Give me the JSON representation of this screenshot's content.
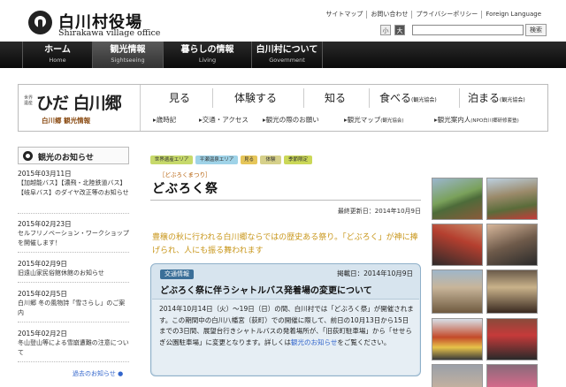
{
  "header": {
    "title": "白川村役場",
    "subtitle": "Shirakawa village office",
    "util_links": [
      "サイトマップ",
      "お問い合わせ",
      "プライバシーポリシー",
      "Foreign Language"
    ],
    "font_small": "小",
    "font_large": "大",
    "search_button": "検索"
  },
  "nav": [
    {
      "jp": "ホーム",
      "en": "Home"
    },
    {
      "jp": "観光情報",
      "en": "Sightseeing"
    },
    {
      "jp": "暮らしの情報",
      "en": "Living"
    },
    {
      "jp": "白川村について",
      "en": "Government"
    }
  ],
  "banner": {
    "logo_title": "ひだ 白川郷",
    "logo_tiny": "世界遺産",
    "logo_sub": "白川郷 観光情報",
    "categories": [
      {
        "label": "見る",
        "note": ""
      },
      {
        "label": "体験する",
        "note": ""
      },
      {
        "label": "知る",
        "note": ""
      },
      {
        "label": "食べる",
        "note": "(観光協会)"
      },
      {
        "label": "泊まる",
        "note": "(観光協会)"
      }
    ],
    "sub_links": [
      {
        "label": "歳時記",
        "note": ""
      },
      {
        "label": "交通・アクセス",
        "note": ""
      },
      {
        "label": "観光の際のお願い",
        "note": ""
      },
      {
        "label": "観光マップ",
        "note": "(観光協会)"
      },
      {
        "label": "観光案内人",
        "note": "(NPO白川郷研修套塾)"
      }
    ]
  },
  "news": {
    "heading": "観光のお知らせ",
    "items": [
      {
        "date": "2015年03月11日",
        "text": "【加越能バス】【濃飛・北陸鉄道バス】【岐阜バス】のダイヤ改正等のお知らせ"
      },
      {
        "date": "2015年02月23日",
        "text": "セルフリノベーション・ワークショップを開催します！"
      },
      {
        "date": "2015年02月9日",
        "text": "旧遠山家民俗館休館のお知らせ"
      },
      {
        "date": "2015年02月5日",
        "text": "白川郷 冬の風物詩「雪さらし」のご案内"
      },
      {
        "date": "2015年02月2日",
        "text": "冬山登山等による雪崩遭難の注意について"
      }
    ],
    "more": "過去のお知らせ ●"
  },
  "article": {
    "tags": [
      "世界遺産エリア",
      "平瀬温泉エリア",
      "見る",
      "体験",
      "季節限定"
    ],
    "kana": "［どぶろくまつり］",
    "title": "どぶろく祭",
    "last_updated": "最終更新日：2014年10月9日",
    "lead": "豊穣の秋に行われる白川郷ならではの歴史ある祭り。「どぶろく」が神に捧げられ、人にも振る舞われます",
    "notice": {
      "badge": "交通情報",
      "date": "掲載日：2014年10月9日",
      "title": "どぶろく祭に伴うシャトルバス発着場の変更について",
      "body": "2014年10月14日（火）～19日（日）の間、白川村では「どぶろく祭」が開催されます。この期間中の白川八幡宮（荻町）での開催に際して、前日の10月13日から15日までの3日間、展望台行きシャトルバスの発着場所が、「旧荻町駐車場」から「せせらぎ公園駐車場」に変更となります。詳しくは",
      "link": "観光のお知らせ",
      "tail": "をご覧ください。"
    }
  },
  "photos": [
    "photo-scene",
    "photo-scene",
    "photo-scene",
    "photo-scene",
    "photo-scene",
    "photo-scene",
    "photo-scene",
    "photo-scene",
    "photo-scene",
    "photo-scene"
  ]
}
